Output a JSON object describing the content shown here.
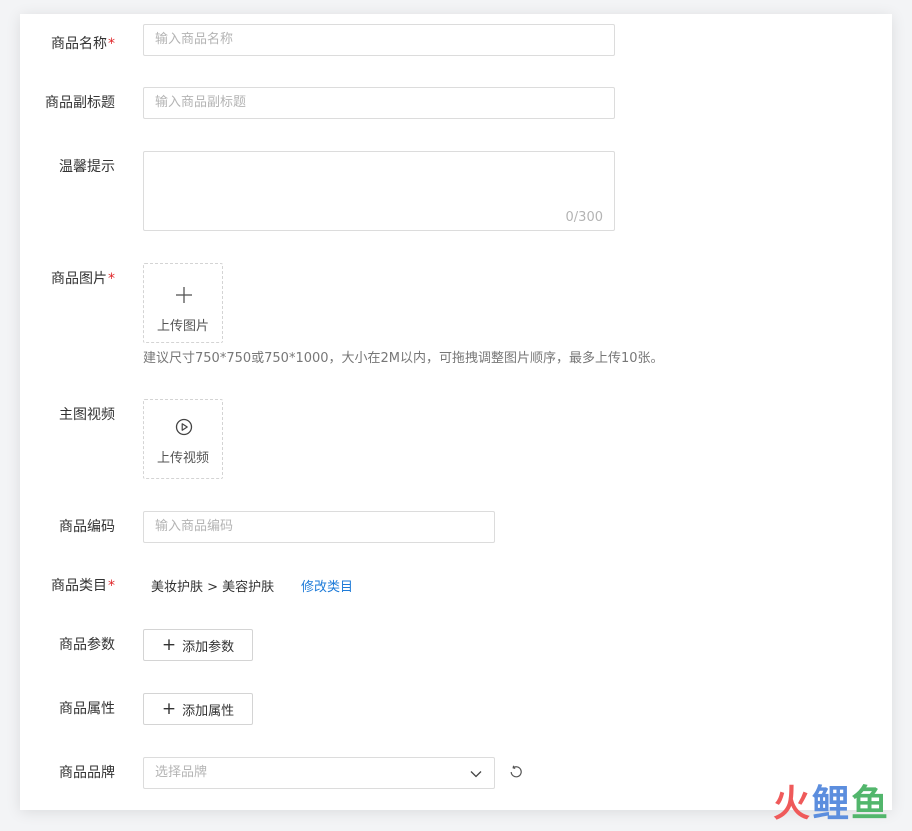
{
  "form": {
    "name": {
      "label": "商品名称",
      "required": "*",
      "placeholder": "输入商品名称"
    },
    "subtitle": {
      "label": "商品副标题",
      "placeholder": "输入商品副标题"
    },
    "tips": {
      "label": "温馨提示",
      "counter": "0/300"
    },
    "images": {
      "label": "商品图片",
      "required": "*",
      "upload_text": "上传图片",
      "hint": "建议尺寸750*750或750*1000，大小在2M以内，可拖拽调整图片顺序，最多上传10张。"
    },
    "video": {
      "label": "主图视频",
      "upload_text": "上传视频"
    },
    "code": {
      "label": "商品编码",
      "placeholder": "输入商品编码"
    },
    "category": {
      "label": "商品类目",
      "required": "*",
      "value": "美妆护肤 > 美容护肤",
      "link": "修改类目"
    },
    "params": {
      "label": "商品参数",
      "button": "添加参数"
    },
    "attrs": {
      "label": "商品属性",
      "button": "添加属性"
    },
    "brand": {
      "label": "商品品牌",
      "placeholder": "选择品牌"
    }
  },
  "icons": [
    "plus-icon",
    "play-circle-icon",
    "chevron-down-icon",
    "refresh-icon"
  ],
  "colors": {
    "required": "#e0262a",
    "link": "#1e7bd8",
    "border": "#dcdcdc"
  },
  "watermark": {
    "part1": "火",
    "part2": "鲤",
    "part3": "鱼"
  }
}
